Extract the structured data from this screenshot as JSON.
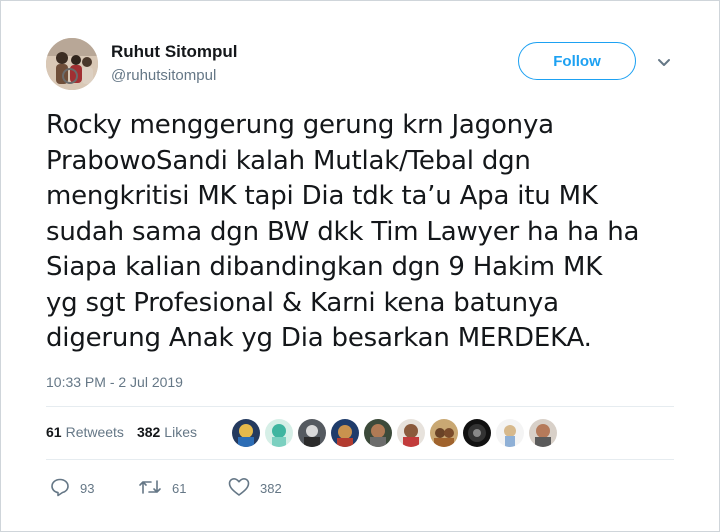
{
  "user": {
    "display_name": "Ruhut Sitompul",
    "handle": "@ruhutsitompul"
  },
  "follow_label": "Follow",
  "tweet": {
    "text": "Rocky menggerung gerung krn Jagonya\nPrabowoSandi kalah Mutlak/Tebal dgn\nmengkritisi MK tapi Dia tdk ta’u Apa itu MK\nsudah sama dgn BW dkk Tim Lawyer ha ha ha\nSiapa kalian dibandingkan dgn 9 Hakim MK\nyg sgt Profesional & Karni kena batunya\ndigerung Anak yg Dia besarkan MERDEKA.",
    "timestamp": "10:33 PM - 2 Jul 2019"
  },
  "stats": {
    "retweets_count": "61",
    "retweets_label": "Retweets",
    "likes_count": "382",
    "likes_label": "Likes"
  },
  "actions": {
    "reply_count": "93",
    "retweet_count": "61",
    "like_count": "382"
  },
  "colors": {
    "accent": "#1da1f2",
    "secondary_text": "#657786",
    "divider": "#e6ecf0"
  },
  "icons": [
    "chevron-down-icon",
    "reply-icon",
    "retweet-icon",
    "heart-icon"
  ]
}
